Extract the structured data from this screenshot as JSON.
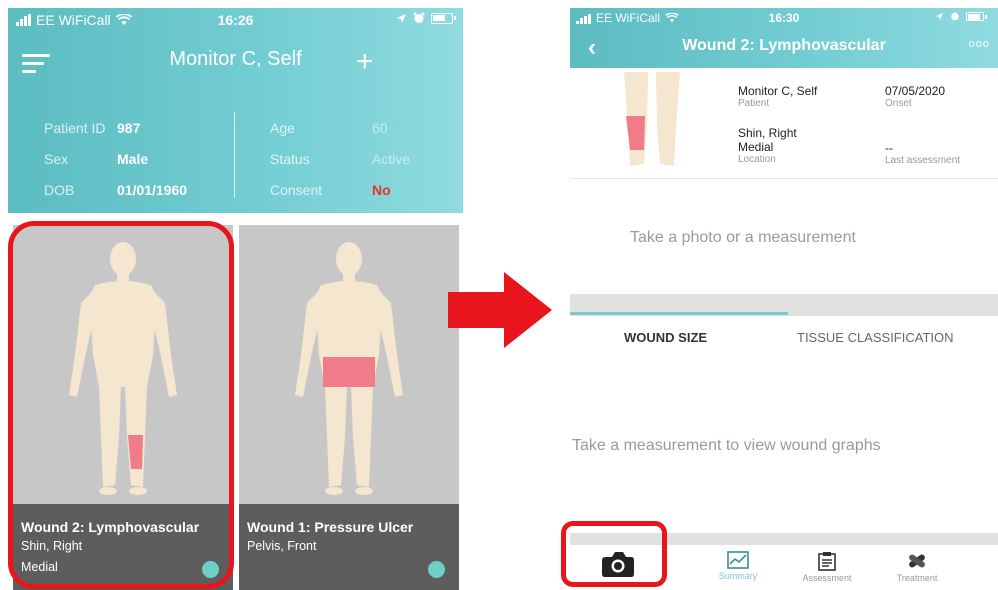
{
  "left": {
    "status": {
      "carrier": "EE WiFiCall",
      "time": "16:26"
    },
    "header": {
      "title": "Monitor C, Self"
    },
    "patient_left": [
      {
        "label": "Patient ID",
        "value": "987"
      },
      {
        "label": "Sex",
        "value": "Male"
      },
      {
        "label": "DOB",
        "value": "01/01/1960"
      }
    ],
    "patient_right": [
      {
        "label": "Age",
        "value": "60"
      },
      {
        "label": "Status",
        "value": "Active"
      },
      {
        "label": "Consent",
        "value": "No"
      }
    ],
    "wounds": [
      {
        "title": "Wound 2: Lymphovascular",
        "line1": "Shin, Right",
        "line2": "Medial"
      },
      {
        "title": "Wound 1: Pressure Ulcer",
        "line1": "Pelvis, Front",
        "line2": ""
      }
    ]
  },
  "right": {
    "status": {
      "carrier": "EE WiFiCall",
      "time": "16:30"
    },
    "header": {
      "title": "Wound 2: Lymphovascular",
      "more": "ooo"
    },
    "meta": {
      "patient_value": "Monitor C, Self",
      "patient_label": "Patient",
      "onset_value": "07/05/2020",
      "onset_label": "Onset",
      "location_value_1": "Shin, Right",
      "location_value_2": "Medial",
      "location_label": "Location",
      "last_value": "--",
      "last_label": "Last assessment"
    },
    "photo_prompt": "Take a photo or a measurement",
    "tabs": {
      "size": "WOUND SIZE",
      "tissue": "TISSUE CLASSIFICATION"
    },
    "graph_prompt": "Take a measurement to view wound graphs",
    "nav": {
      "summary": "Summary",
      "assessment": "Assessment",
      "treatment": "Treatment"
    }
  },
  "colors": {
    "accent": "#6cc6cc",
    "highlight": "#e8161c",
    "wound": "#f07c8a",
    "skin": "#f4e6cf",
    "consent_no": "#e4312f"
  }
}
